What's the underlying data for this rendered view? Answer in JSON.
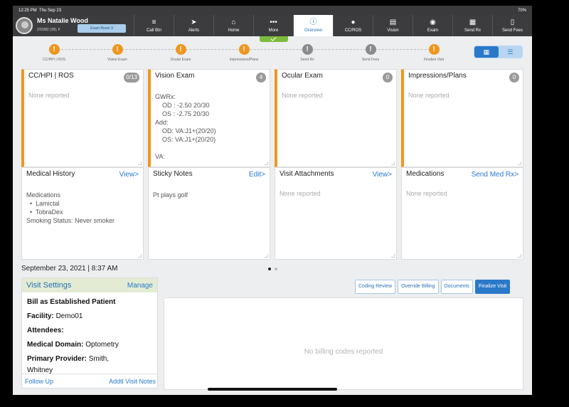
{
  "status_bar": {
    "time": "12:25 PM",
    "date": "Thu Sep 23",
    "right": "70%"
  },
  "patient": {
    "name": "Ms Natalie Wood",
    "dob": "2/15/82 (39), F",
    "exam_room": "Exam Room 3"
  },
  "nav": [
    {
      "label": "Call Btn",
      "icon": "≡",
      "name": "call-btn"
    },
    {
      "label": "Alerts",
      "icon": "➤",
      "name": "alerts"
    },
    {
      "label": "Home",
      "icon": "⌂",
      "name": "home"
    },
    {
      "label": "More",
      "icon": "•••",
      "name": "more"
    },
    {
      "label": "Overview",
      "icon": "ⓘ",
      "name": "overview",
      "active": true
    },
    {
      "label": "CC/ROS",
      "icon": "●",
      "name": "cc-ros"
    },
    {
      "label": "Vision",
      "icon": "▤",
      "name": "vision"
    },
    {
      "label": "Exam",
      "icon": "◉",
      "name": "exam"
    },
    {
      "label": "Send Rx",
      "icon": "▦",
      "name": "send-rx"
    },
    {
      "label": "Send Fees",
      "icon": "▯",
      "name": "send-fees"
    }
  ],
  "progress_steps": [
    {
      "label": "CC/HPI | ROS",
      "state": "orange"
    },
    {
      "label": "Vision Exam",
      "state": "orange"
    },
    {
      "label": "Ocular Exam",
      "state": "orange"
    },
    {
      "label": "Impressions/Plans",
      "state": "orange"
    },
    {
      "label": "Send Rx",
      "state": "gray"
    },
    {
      "label": "Send Fees",
      "state": "gray"
    },
    {
      "label": "Finalize Visit",
      "state": "orange"
    }
  ],
  "cards_top": [
    {
      "title": "CC/HPI | ROS",
      "badge": "0/13",
      "empty": "None reported"
    },
    {
      "title": "Vision Exam",
      "badge": "4",
      "lines": [
        "GWRx:",
        "    OD : -2.50 20/30",
        "    OS : -2.75 20/30",
        "Add:",
        "    OD: VA:J1+(20/20)",
        "    OS: VA:J1+(20/20)",
        "",
        "VA:"
      ]
    },
    {
      "title": "Ocular Exam",
      "badge": "0",
      "empty": "None reported"
    },
    {
      "title": "Impressions/Plans",
      "badge": "0",
      "empty": "None reported"
    }
  ],
  "cards_bottom": [
    {
      "title": "Medical History",
      "link": "View>",
      "lines": [
        "Medications",
        "  •  Lamictal",
        "  •  TobraDex",
        "Smoking Status: Never smoker"
      ]
    },
    {
      "title": "Sticky Notes",
      "link": "Edit>",
      "lines": [
        "Pt plays golf"
      ]
    },
    {
      "title": "Visit Attachments",
      "link": "View>",
      "empty": "None reported"
    },
    {
      "title": "Medications",
      "link": "Send Med Rx>",
      "empty": "None reported"
    }
  ],
  "visit_date": "September 23, 2021 | 8:37 AM",
  "visit_settings": {
    "title": "Visit Settings",
    "manage": "Manage",
    "bill_as": "Bill as Established Patient",
    "facility_label": "Facility:",
    "facility": "Demo01",
    "attendees_label": "Attendees:",
    "domain_label": "Medical Domain:",
    "domain": "Optometry",
    "provider_label": "Primary Provider:",
    "provider": "Smith,",
    "provider_cont": "Whitney",
    "follow_up": "Follow Up",
    "addtl_notes": "Addtl Visit Notes"
  },
  "actions": {
    "coding_review": "Coding Review",
    "override_billing": "Override Billing",
    "documents": "Documents",
    "finalize_visit": "Finalize Visit"
  },
  "billing_empty": "No billing codes reported",
  "colors": {
    "accent_orange": "#f0961e",
    "primary_blue": "#2a79c9",
    "nav_dark": "#3c3c3e"
  }
}
